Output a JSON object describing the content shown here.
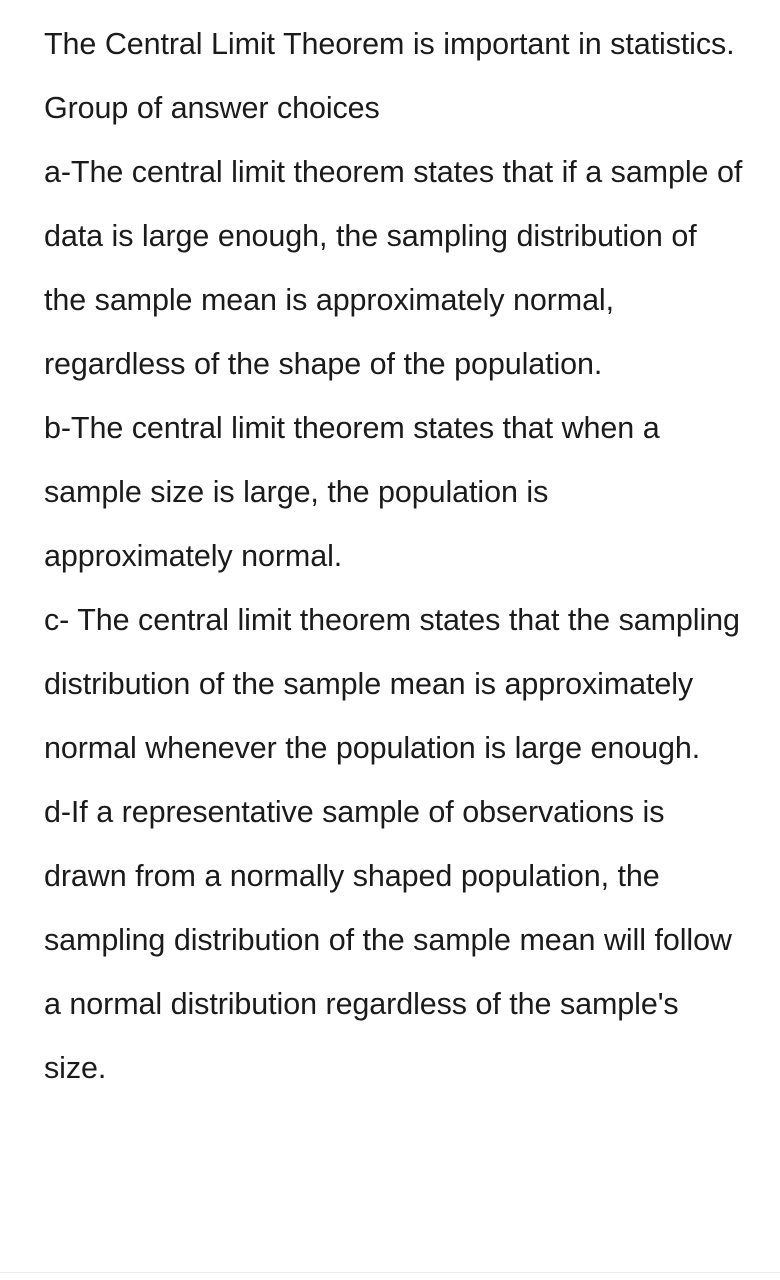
{
  "document": {
    "background_color": "#ffffff",
    "text_color": "#1b1b1b",
    "rule_color": "#ececec"
  },
  "question": {
    "stem": "The Central Limit Theorem is important in statistics.",
    "choices_label": "Group of answer choices",
    "choices": [
      {
        "key": "a",
        "text": "a-The central limit theorem states that if a sample of data is large enough, the sampling distribution of the sample mean is approximately normal, regardless of the shape of the population."
      },
      {
        "key": "b",
        "text": "b-The central limit theorem states that when a sample size is large, the population is approximately normal."
      },
      {
        "key": "c",
        "text": "c- The central limit theorem states that the sampling distribution of the sample mean is approximately normal whenever the population is large enough."
      },
      {
        "key": "d",
        "text": "d-If a representative sample of observations is drawn from a normally shaped population, the sampling distribution of the sample mean will follow a normal distribution regardless of the sample's size."
      }
    ]
  }
}
